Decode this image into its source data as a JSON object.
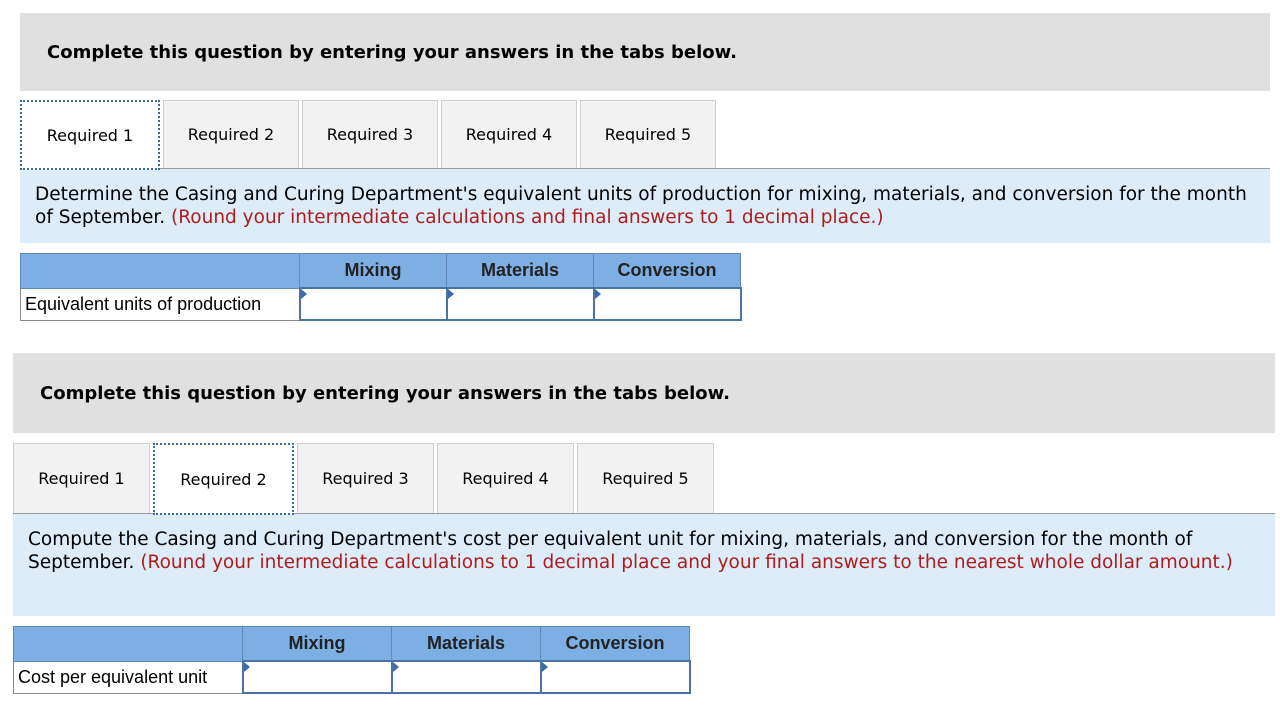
{
  "sections": [
    {
      "banner": "Complete this question by entering your answers in the tabs below.",
      "tabs": [
        {
          "label": "Required 1",
          "active": true
        },
        {
          "label": "Required 2",
          "active": false
        },
        {
          "label": "Required 3",
          "active": false
        },
        {
          "label": "Required 4",
          "active": false
        },
        {
          "label": "Required 5",
          "active": false
        }
      ],
      "instruction": {
        "text": "Determine the Casing and Curing Department's equivalent units of production for mixing, materials, and conversion for the month of September.",
        "note": "(Round your intermediate calculations and final answers to 1 decimal place.)"
      },
      "table": {
        "columns": [
          "",
          "Mixing",
          "Materials",
          "Conversion"
        ],
        "rows": [
          {
            "label": "Equivalent units of production",
            "values": [
              "",
              "",
              ""
            ]
          }
        ]
      }
    },
    {
      "banner": "Complete this question by entering your answers in the tabs below.",
      "tabs": [
        {
          "label": "Required 1",
          "active": false
        },
        {
          "label": "Required 2",
          "active": true
        },
        {
          "label": "Required 3",
          "active": false
        },
        {
          "label": "Required 4",
          "active": false
        },
        {
          "label": "Required 5",
          "active": false
        }
      ],
      "instruction": {
        "text": "Compute the Casing and Curing Department's cost per equivalent unit for mixing, materials, and conversion for the month of September.",
        "note": "(Round your intermediate calculations to 1 decimal place and your final answers to the nearest whole dollar amount.)"
      },
      "table": {
        "columns": [
          "",
          "Mixing",
          "Materials",
          "Conversion"
        ],
        "rows": [
          {
            "label": "Cost per equivalent unit",
            "values": [
              "",
              "",
              ""
            ]
          }
        ]
      }
    }
  ]
}
